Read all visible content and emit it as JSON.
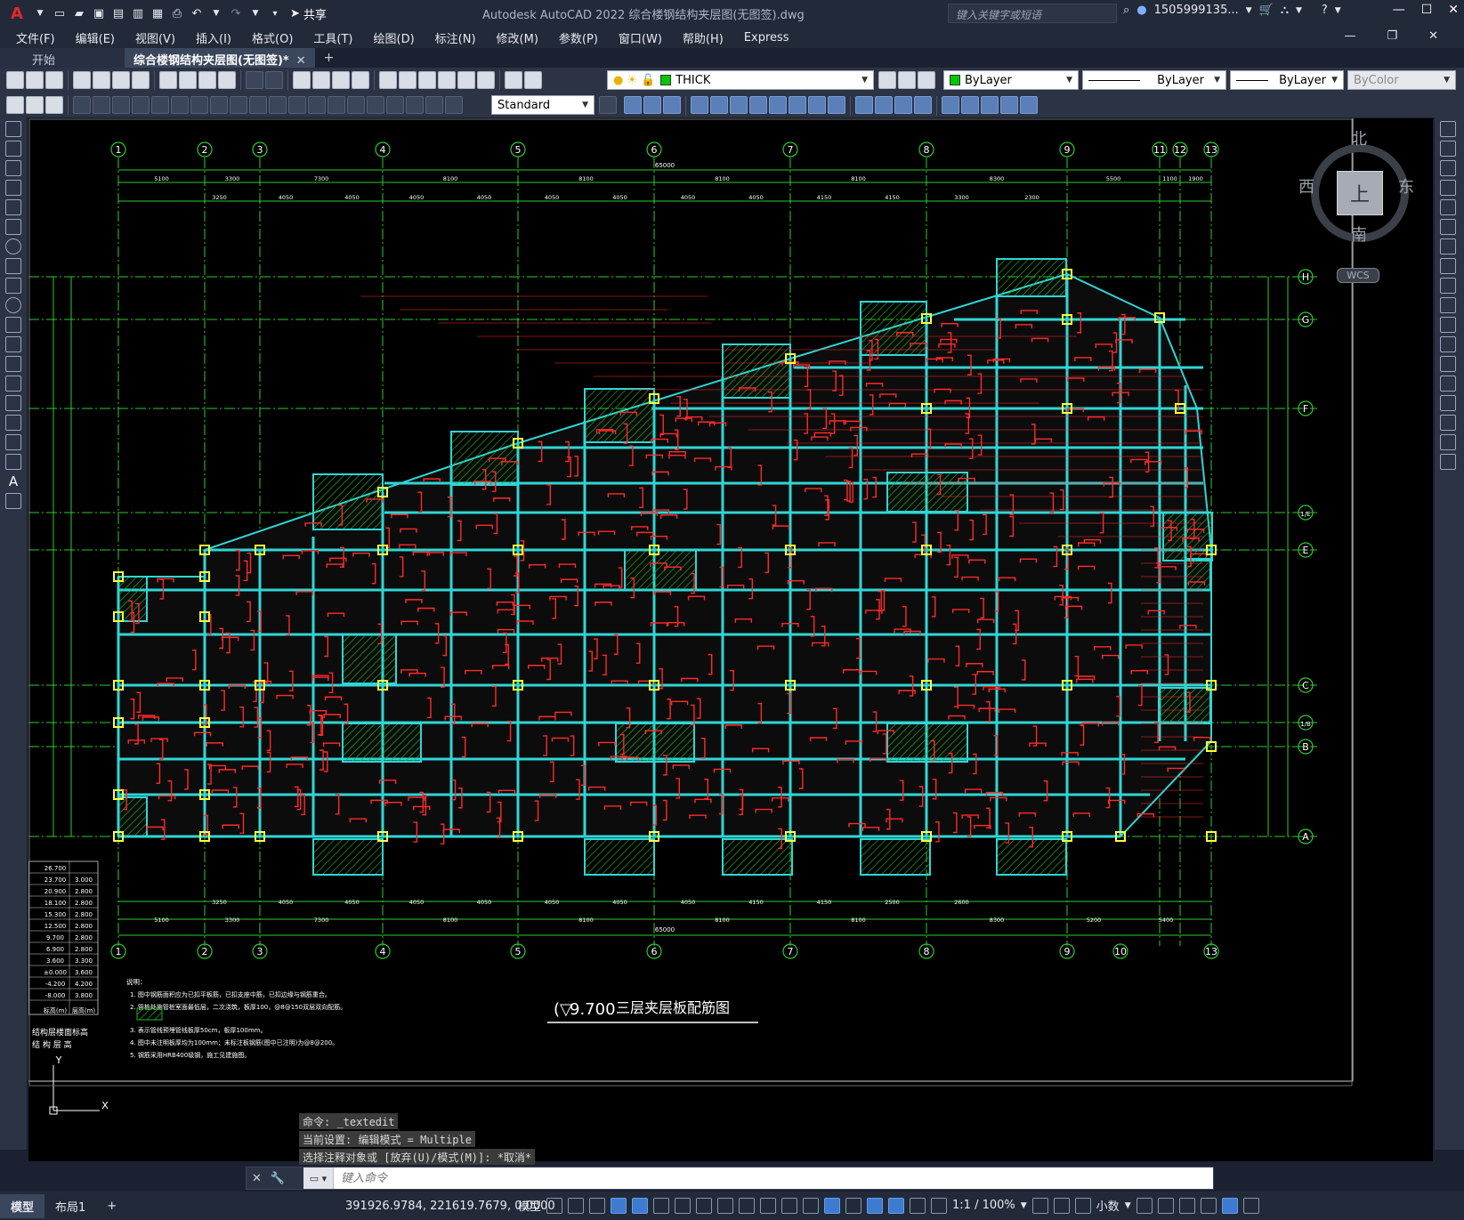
{
  "window": {
    "title": "Autodesk AutoCAD 2022    综合楼钢结构夹层图(无图签).dwg",
    "share_label": "共享",
    "search_placeholder": "键入关键字或短语",
    "user": "1505999135..."
  },
  "menu": [
    "文件(F)",
    "编辑(E)",
    "视图(V)",
    "插入(I)",
    "格式(O)",
    "工具(T)",
    "绘图(D)",
    "标注(N)",
    "修改(M)",
    "参数(P)",
    "窗口(W)",
    "帮助(H)",
    "Express"
  ],
  "tabs": [
    {
      "label": "开始",
      "active": false
    },
    {
      "label": "综合楼钢结构夹层图(无图签)*",
      "active": true
    }
  ],
  "toolbar": {
    "layer_value": "THICK",
    "color_value": "ByLayer",
    "linetype_value": "ByLayer",
    "lineweight_value": "ByLayer",
    "plotstyle_value": "ByColor",
    "textstyle_value": "Standard"
  },
  "navcube": {
    "north": "北",
    "south": "南",
    "east": "东",
    "west": "西",
    "face": "上",
    "wcs": "WCS"
  },
  "drawing": {
    "title": "三层夹层板配筋图",
    "elevation": "9.700",
    "top_axes": [
      "1",
      "2",
      "3",
      "4",
      "5",
      "6",
      "7",
      "8",
      "9",
      "11",
      "12",
      "13"
    ],
    "bottom_axes": [
      "1",
      "2",
      "3",
      "4",
      "5",
      "6",
      "7",
      "8",
      "9",
      "10",
      "13"
    ],
    "right_axes": [
      "H",
      "G",
      "F",
      "1/E",
      "E",
      "C",
      "1/B",
      "B",
      "A"
    ],
    "overall_dim": "65000",
    "top_dims_row1": [
      "5100",
      "3300",
      "7300",
      "8100",
      "8100",
      "8100",
      "8100",
      "8300",
      "5500",
      "1100",
      "1900"
    ],
    "top_dims_row2": [
      "3250",
      "4050",
      "4050",
      "4050",
      "4050",
      "4050",
      "4050",
      "4050",
      "4050",
      "4150",
      "4150",
      "3300",
      "2300"
    ],
    "bottom_dims_row1": [
      "3250",
      "4050",
      "4050",
      "4050",
      "4050",
      "4050",
      "4050",
      "4050",
      "4150",
      "4150",
      "2500",
      "2600"
    ],
    "bottom_dims_row2": [
      "5100",
      "3300",
      "7300",
      "8100",
      "8100",
      "8100",
      "8100",
      "8300",
      "5200",
      "5400"
    ],
    "elev_table_headers": [
      "结构层楼面标高",
      "结 构 层 高"
    ],
    "elev_table": [
      [
        "26.700",
        ""
      ],
      [
        "23.700",
        "3.000"
      ],
      [
        "20.900",
        "2.800"
      ],
      [
        "18.100",
        "2.800"
      ],
      [
        "15.300",
        "2.800"
      ],
      [
        "12.500",
        "2.800"
      ],
      [
        "9.700",
        "2.800"
      ],
      [
        "6.900",
        "2.800"
      ],
      [
        "3.600",
        "3.300"
      ],
      [
        "±0.000",
        "3.600"
      ],
      [
        "-4.200",
        "4.200"
      ],
      [
        "-8.000",
        "3.800"
      ]
    ],
    "elev_table_footer": [
      "标高(m)",
      "层高(m)"
    ],
    "notes_title": "说明：",
    "notes": [
      "1. 图中钢筋面积应为已扣平板筋，已扣支座中筋，已扣边缘与钢筋重合。",
      "2. 管桩处施管桩室面最低层，二次浇筑，板厚100，@8@150双层双向配筋。",
      "3. 表示管线预埋管线板厚50cm，板厚100mm。",
      "4. 图中未注明板厚均为100mm；未标注板钢筋(图中已注明)为@8@200。",
      "5. 钢筋采用HRB400级钢，施工见建施图。"
    ]
  },
  "command_history": [
    "命令: _textedit",
    "当前设置: 编辑模式 = Multiple",
    "选择注释对象或 [放弃(U)/模式(M)]: *取消*"
  ],
  "command_placeholder": "键入命令",
  "status": {
    "tabs": [
      {
        "label": "模型",
        "active": true
      },
      {
        "label": "布局1",
        "active": false
      }
    ],
    "coords": "391926.9784, 221619.7679, 0.0000",
    "space": "模型",
    "scale": "1:1 / 100%",
    "units": "小数"
  }
}
